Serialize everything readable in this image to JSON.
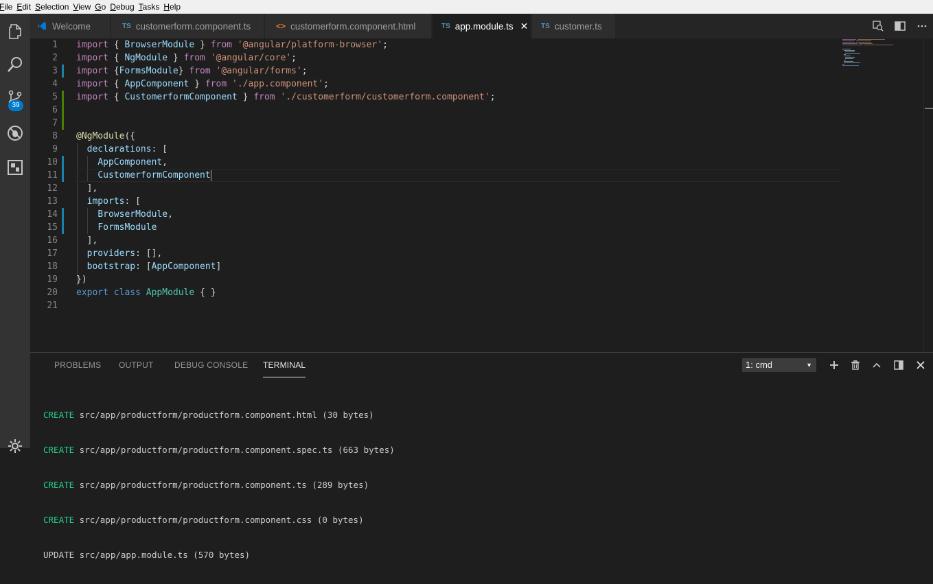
{
  "menu": [
    "File",
    "Edit",
    "Selection",
    "View",
    "Go",
    "Debug",
    "Tasks",
    "Help"
  ],
  "menu_mnemonics": [
    "F",
    "E",
    "S",
    "V",
    "G",
    "D",
    "T",
    "H"
  ],
  "activity_bar": {
    "icons": [
      "explorer-icon",
      "search-icon",
      "source-control-icon",
      "debug-icon",
      "extensions-icon"
    ],
    "scm_badge": "39"
  },
  "tabs": [
    {
      "icon": "",
      "label": "Welcome",
      "active": false
    },
    {
      "icon": "TS",
      "label": "customerform.component.ts",
      "active": false
    },
    {
      "icon": "<>",
      "label": "customerform.component.html",
      "active": false
    },
    {
      "icon": "TS",
      "label": "app.module.ts",
      "active": true,
      "close": "✕"
    },
    {
      "icon": "TS",
      "label": "customer.ts",
      "active": false
    }
  ],
  "editor": {
    "line_numbers": [
      "1",
      "2",
      "3",
      "4",
      "5",
      "6",
      "7",
      "8",
      "9",
      "10",
      "11",
      "12",
      "13",
      "14",
      "15",
      "16",
      "17",
      "18",
      "19",
      "20",
      "21"
    ],
    "lines": [
      [
        [
          "k",
          "import"
        ],
        [
          "p",
          " { "
        ],
        [
          "v",
          "BrowserModule"
        ],
        [
          "p",
          " } "
        ],
        [
          "k",
          "from"
        ],
        [
          "p",
          " "
        ],
        [
          "s",
          "'@angular/platform-browser'"
        ],
        [
          "p",
          ";"
        ]
      ],
      [
        [
          "k",
          "import"
        ],
        [
          "p",
          " { "
        ],
        [
          "v",
          "NgModule"
        ],
        [
          "p",
          " } "
        ],
        [
          "k",
          "from"
        ],
        [
          "p",
          " "
        ],
        [
          "s",
          "'@angular/core'"
        ],
        [
          "p",
          ";"
        ]
      ],
      [
        [
          "k",
          "import"
        ],
        [
          "p",
          " {"
        ],
        [
          "v",
          "FormsModule"
        ],
        [
          "p",
          "} "
        ],
        [
          "k",
          "from"
        ],
        [
          "p",
          " "
        ],
        [
          "s",
          "'@angular/forms'"
        ],
        [
          "p",
          ";"
        ]
      ],
      [
        [
          "k",
          "import"
        ],
        [
          "p",
          " { "
        ],
        [
          "v",
          "AppComponent"
        ],
        [
          "p",
          " } "
        ],
        [
          "k",
          "from"
        ],
        [
          "p",
          " "
        ],
        [
          "s",
          "'./app.component'"
        ],
        [
          "p",
          ";"
        ]
      ],
      [
        [
          "k",
          "import"
        ],
        [
          "p",
          " { "
        ],
        [
          "v",
          "CustomerformComponent"
        ],
        [
          "p",
          " } "
        ],
        [
          "k",
          "from"
        ],
        [
          "p",
          " "
        ],
        [
          "s",
          "'./customerform/customerform.component'"
        ],
        [
          "p",
          ";"
        ]
      ],
      [],
      [],
      [
        [
          "f",
          "@NgModule"
        ],
        [
          "p",
          "({"
        ]
      ],
      [
        [
          "p",
          "  "
        ],
        [
          "v",
          "declarations"
        ],
        [
          "p",
          ": ["
        ]
      ],
      [
        [
          "p",
          "    "
        ],
        [
          "v",
          "AppComponent"
        ],
        [
          "p",
          ","
        ]
      ],
      [
        [
          "p",
          "    "
        ],
        [
          "v",
          "CustomerformComponent"
        ]
      ],
      [
        [
          "p",
          "  ],"
        ]
      ],
      [
        [
          "p",
          "  "
        ],
        [
          "v",
          "imports"
        ],
        [
          "p",
          ": ["
        ]
      ],
      [
        [
          "p",
          "    "
        ],
        [
          "v",
          "BrowserModule"
        ],
        [
          "p",
          ","
        ]
      ],
      [
        [
          "p",
          "    "
        ],
        [
          "v",
          "FormsModule"
        ]
      ],
      [
        [
          "p",
          "  ],"
        ]
      ],
      [
        [
          "p",
          "  "
        ],
        [
          "v",
          "providers"
        ],
        [
          "p",
          ": [],"
        ]
      ],
      [
        [
          "p",
          "  "
        ],
        [
          "v",
          "bootstrap"
        ],
        [
          "p",
          ": ["
        ],
        [
          "v",
          "AppComponent"
        ],
        [
          "p",
          "]"
        ]
      ],
      [
        [
          "p",
          "})"
        ]
      ],
      [
        [
          "kb",
          "export"
        ],
        [
          "p",
          " "
        ],
        [
          "kb",
          "class"
        ],
        [
          "p",
          " "
        ],
        [
          "t",
          "AppModule"
        ],
        [
          "p",
          " { }"
        ]
      ],
      []
    ],
    "cursor_line": 11
  },
  "panel": {
    "tabs": [
      "PROBLEMS",
      "OUTPUT",
      "DEBUG CONSOLE",
      "TERMINAL"
    ],
    "active_tab": "TERMINAL",
    "terminal_select": "1: cmd",
    "terminal_lines": [
      {
        "op": "CREATE",
        "text": " src/app/productform/productform.component.html (30 bytes)"
      },
      {
        "op": "CREATE",
        "text": " src/app/productform/productform.component.spec.ts (663 bytes)"
      },
      {
        "op": "CREATE",
        "text": " src/app/productform/productform.component.ts (289 bytes)"
      },
      {
        "op": "CREATE",
        "text": " src/app/productform/productform.component.css (0 bytes)"
      },
      {
        "op": "UPDATE",
        "text": " src/app/app.module.ts (570 bytes)"
      }
    ]
  },
  "colors": {
    "accent": "#007acc",
    "keyword": "#c586c0",
    "string": "#ce9178",
    "variable": "#9cdcfe",
    "type": "#4ec9b0",
    "terminal_create": "#23d18b"
  }
}
